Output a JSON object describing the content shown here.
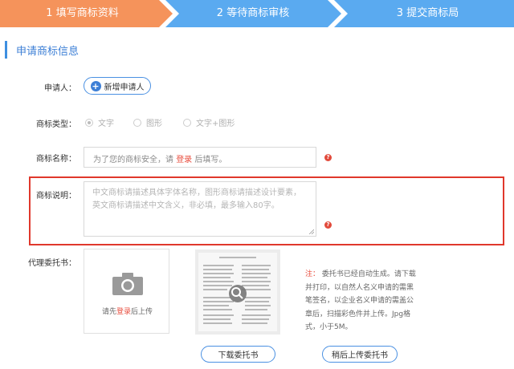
{
  "steps": [
    {
      "label": "1 填写商标资料",
      "color": "#f5935b"
    },
    {
      "label": "2 等待商标审核",
      "color": "#5aaaf0"
    },
    {
      "label": "3 提交商标局",
      "color": "#5aaaf0"
    }
  ],
  "section": {
    "title": "申请商标信息"
  },
  "form": {
    "applicant_label": "申请人：",
    "add_applicant_label": "新增申请人",
    "type_label": "商标类型：",
    "type_options": [
      {
        "label": "文字",
        "checked": true
      },
      {
        "label": "图形",
        "checked": false
      },
      {
        "label": "文字+图形",
        "checked": false
      }
    ],
    "name_label": "商标名称：",
    "name_placeholder_prefix": "为了您的商标安全，请",
    "name_login_link": "登录",
    "name_placeholder_suffix": "后填写。",
    "desc_label": "商标说明：",
    "desc_placeholder_line1": "中文商标请描述具体字体名称，图形商标请描述设计要素，",
    "desc_placeholder_line2": "英文商标请描述中文含义，非必填，最多输入80字。",
    "proxy_label": "代理委托书：",
    "upload_prefix": "请先",
    "upload_login_link": "登录",
    "upload_suffix": "后上传",
    "note_prefix": "注：",
    "note_text": "委托书已经自动生成。请下载并打印，以自然人名义申请的需黑笔签名，以企业名义申请的需盖公章后，扫描彩色件并上传。Jpg格式，小于5M。",
    "download_button": "下载委托书",
    "upload_later_button": "稍后上传委托书"
  },
  "icons": {
    "help": "?"
  }
}
